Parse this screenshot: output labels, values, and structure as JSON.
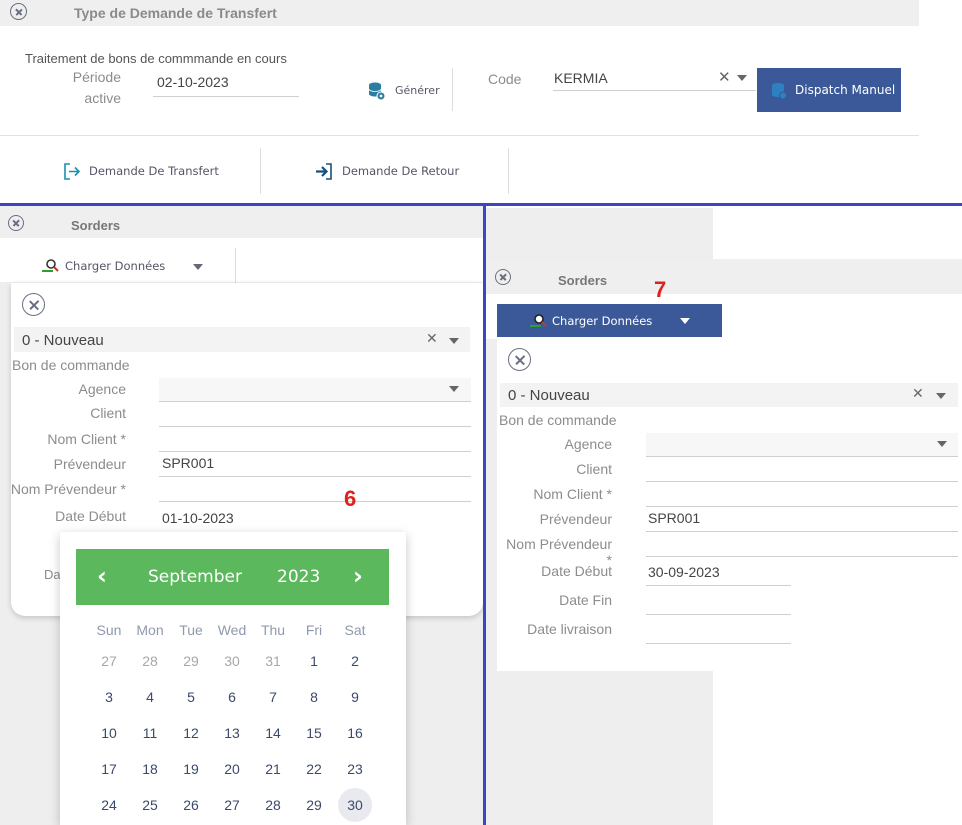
{
  "top_panel": {
    "title": "Type de Demande de Transfert",
    "subtitle": "Traitement de bons de commmande en cours",
    "period_label_1": "Période",
    "period_label_2": "active",
    "period_value": "02-10-2023",
    "generate_label": "Générer",
    "code_label": "Code",
    "code_value": "KERMIA",
    "dispatch_label": "Dispatch Manuel",
    "transfer_label": "Demande De Transfert",
    "return_label": "Demande De Retour"
  },
  "left_panel": {
    "title": "Sorders",
    "load_label": "Charger Données",
    "status_value": "0 - Nouveau",
    "bon_label": "Bon de commande",
    "agence_label": "Agence",
    "client_label": "Client",
    "nom_client_label": "Nom Client *",
    "prevendeur_label": "Prévendeur",
    "prevendeur_value": "SPR001",
    "nom_prevendeur_label": "Nom Prévendeur *",
    "date_debut_label": "Date Début",
    "date_debut_value": "01-10-2023",
    "hidden_label_fragment": "Da",
    "annotation": "6"
  },
  "calendar": {
    "month": "September",
    "year": "2023",
    "prev_symbol": "‹",
    "next_symbol": "›",
    "weekdays": [
      "Sun",
      "Mon",
      "Tue",
      "Wed",
      "Thu",
      "Fri",
      "Sat"
    ],
    "weeks": [
      [
        "27",
        "28",
        "29",
        "30",
        "31",
        "1",
        "2"
      ],
      [
        "3",
        "4",
        "5",
        "6",
        "7",
        "8",
        "9"
      ],
      [
        "10",
        "11",
        "12",
        "13",
        "14",
        "15",
        "16"
      ],
      [
        "17",
        "18",
        "19",
        "20",
        "21",
        "22",
        "23"
      ],
      [
        "24",
        "25",
        "26",
        "27",
        "28",
        "29",
        "30"
      ]
    ],
    "selected_day": "30",
    "accent_color": "#5cb85c"
  },
  "right_panel": {
    "title": "Sorders",
    "load_label": "Charger Données",
    "annotation": "7",
    "status_value": "0 - Nouveau",
    "bon_label": "Bon de commande",
    "agence_label": "Agence",
    "client_label": "Client",
    "nom_client_label": "Nom Client *",
    "prevendeur_label": "Prévendeur",
    "prevendeur_value": "SPR001",
    "nom_prevendeur_label": "Nom Prévendeur *",
    "date_debut_label": "Date Début",
    "date_debut_value": "30-09-2023",
    "date_fin_label": "Date Fin",
    "date_livraison_label": "Date livraison"
  },
  "colors": {
    "primary_button": "#3b5998",
    "annotation_red": "#e0201c",
    "divider_blue": "#3b46c4",
    "icon_teal": "#2a7fa0"
  }
}
